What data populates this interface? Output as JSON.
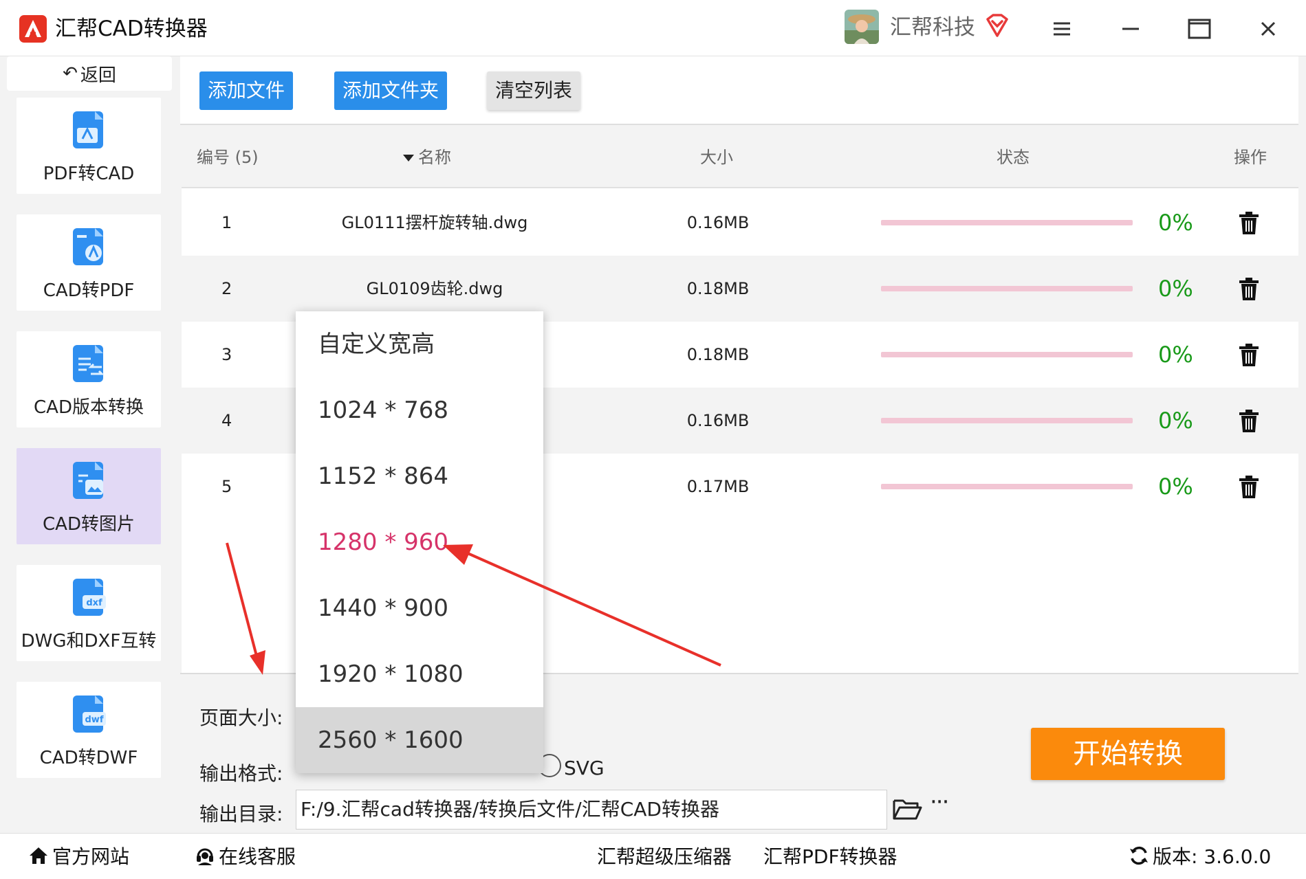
{
  "app": {
    "title": "汇帮CAD转换器",
    "user_name": "汇帮科技"
  },
  "sidebar": {
    "back_label": "返回",
    "items": [
      {
        "label": "PDF转CAD",
        "icon": "pdf-to-cad-icon"
      },
      {
        "label": "CAD转PDF",
        "icon": "cad-to-pdf-icon"
      },
      {
        "label": "CAD版本转换",
        "icon": "cad-version-icon"
      },
      {
        "label": "CAD转图片",
        "icon": "cad-to-image-icon",
        "active": true
      },
      {
        "label": "DWG和DXF互转",
        "icon": "dwg-dxf-icon"
      },
      {
        "label": "CAD转DWF",
        "icon": "cad-to-dwf-icon"
      }
    ]
  },
  "toolbar": {
    "add_file": "添加文件",
    "add_folder": "添加文件夹",
    "clear_list": "清空列表"
  },
  "table": {
    "headers": {
      "index": "编号 (5)",
      "name": "名称",
      "size": "大小",
      "status": "状态",
      "action": "操作"
    },
    "rows": [
      {
        "index": "1",
        "name": "GL0111摆杆旋转轴.dwg",
        "size": "0.16MB",
        "progress": "0%"
      },
      {
        "index": "2",
        "name": "GL0109齿轮.dwg",
        "size": "0.18MB",
        "progress": "0%"
      },
      {
        "index": "3",
        "name": "",
        "size": "0.18MB",
        "progress": "0%"
      },
      {
        "index": "4",
        "name": "",
        "size": "0.16MB",
        "progress": "0%"
      },
      {
        "index": "5",
        "name": "",
        "size": "0.17MB",
        "progress": "0%"
      }
    ]
  },
  "settings": {
    "page_size_label": "页面大小:",
    "output_format_label": "输出格式:",
    "format_option_svg": "SVG",
    "output_dir_label": "输出目录:",
    "output_dir_value": "F:/9.汇帮cad转换器/转换后文件/汇帮CAD转换器",
    "more_label": "···",
    "start_button": "开始转换"
  },
  "page_size_dropdown": {
    "options": [
      "自定义宽高",
      "1024 * 768",
      "1152 * 864",
      "1280 * 960",
      "1440 * 900",
      "1920 * 1080",
      "2560 * 1600"
    ],
    "highlighted": "1280 * 960",
    "hovered": "2560 * 1600"
  },
  "footer": {
    "website": "官方网站",
    "support": "在线客服",
    "compressor": "汇帮超级压缩器",
    "pdf_converter": "汇帮PDF转换器",
    "version": "版本: 3.6.0.0"
  },
  "colors": {
    "primary_blue": "#2a8eea",
    "start_orange": "#fb8a0c",
    "progress_green": "#1a9a1a",
    "progress_track_pink": "#f2c6d4",
    "highlight_pink": "#d63369",
    "sidebar_active": "#e2d9f5",
    "annotation_red": "#e8302a"
  }
}
